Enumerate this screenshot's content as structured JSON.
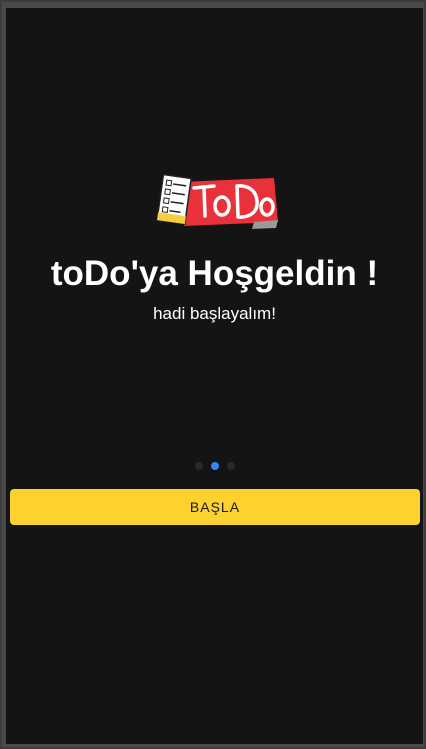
{
  "app": {
    "logo_text": "ToDo",
    "title": "toDo'ya Hoşgeldin !",
    "subtitle": "hadi başlayalım!"
  },
  "pagination": {
    "total": 3,
    "active_index": 1,
    "active_color": "#3b82f6",
    "inactive_color": "#2a2a2a"
  },
  "actions": {
    "start_label": "BAŞLA",
    "start_color": "#fdd22f"
  },
  "theme": {
    "background": "#141414",
    "logo_red": "#e8313a"
  }
}
